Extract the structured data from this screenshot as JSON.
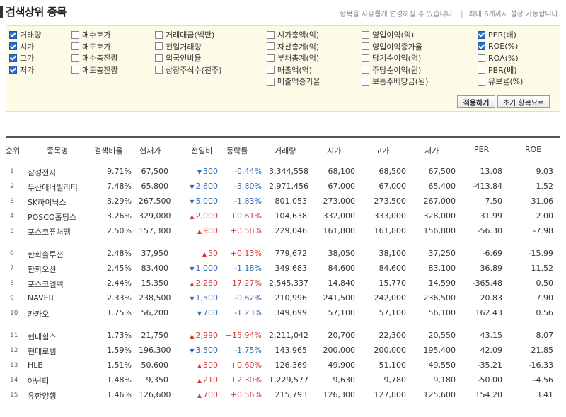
{
  "header": {
    "title": "검색상위 종목",
    "note_left": "항목을 자유롭게 변경하실 수 있습니다.",
    "note_sep": "|",
    "note_right": "최대 6개까지 설정 가능합니다."
  },
  "options": {
    "col1": [
      {
        "label": "거래량",
        "checked": true
      },
      {
        "label": "시가",
        "checked": true
      },
      {
        "label": "고가",
        "checked": true
      },
      {
        "label": "저가",
        "checked": true
      }
    ],
    "col2": [
      {
        "label": "매수호가",
        "checked": false
      },
      {
        "label": "매도호가",
        "checked": false
      },
      {
        "label": "매수총잔량",
        "checked": false
      },
      {
        "label": "매도총잔량",
        "checked": false
      }
    ],
    "col3": [
      {
        "label": "거래대금(백만)",
        "checked": false
      },
      {
        "label": "전일거래량",
        "checked": false
      },
      {
        "label": "외국인비율",
        "checked": false
      },
      {
        "label": "상장주식수(천주)",
        "checked": false
      }
    ],
    "col4": [
      {
        "label": "시가총액(억)",
        "checked": false
      },
      {
        "label": "자산총계(억)",
        "checked": false
      },
      {
        "label": "부채총계(억)",
        "checked": false
      },
      {
        "label": "매출액(억)",
        "checked": false
      },
      {
        "label": "매출액증가율",
        "checked": false
      }
    ],
    "col5": [
      {
        "label": "영업이익(억)",
        "checked": false
      },
      {
        "label": "영업이익증가율",
        "checked": false
      },
      {
        "label": "당기순이익(억)",
        "checked": false
      },
      {
        "label": "주당순이익(원)",
        "checked": false
      },
      {
        "label": "보통주배당금(원)",
        "checked": false
      }
    ],
    "col6": [
      {
        "label": "PER(배)",
        "checked": true
      },
      {
        "label": "ROE(%)",
        "checked": true
      },
      {
        "label": "ROA(%)",
        "checked": false
      },
      {
        "label": "PBR(배)",
        "checked": false
      },
      {
        "label": "유보율(%)",
        "checked": false
      }
    ],
    "apply_button": "적용하기",
    "reset_button": "초기 항목으로"
  },
  "table": {
    "headers": [
      "순위",
      "종목명",
      "검색비율",
      "현재가",
      "전일비",
      "등락률",
      "거래량",
      "시가",
      "고가",
      "저가",
      "PER",
      "ROE"
    ],
    "rows": [
      {
        "no": "1",
        "name": "삼성전자",
        "ratio": "9.71%",
        "price": "67,500",
        "dir": "down",
        "diff": "300",
        "rate": "-0.44%",
        "volume": "3,344,558",
        "open": "68,100",
        "high": "68,500",
        "low": "67,500",
        "per": "13.08",
        "roe": "9.03"
      },
      {
        "no": "2",
        "name": "두산에너빌리티",
        "ratio": "7.48%",
        "price": "65,800",
        "dir": "down",
        "diff": "2,600",
        "rate": "-3.80%",
        "volume": "2,971,456",
        "open": "67,000",
        "high": "67,000",
        "low": "65,400",
        "per": "-413.84",
        "roe": "1.52"
      },
      {
        "no": "3",
        "name": "SK하이닉스",
        "ratio": "3.29%",
        "price": "267,500",
        "dir": "down",
        "diff": "5,000",
        "rate": "-1.83%",
        "volume": "801,053",
        "open": "273,000",
        "high": "273,500",
        "low": "267,000",
        "per": "7.50",
        "roe": "31.06"
      },
      {
        "no": "4",
        "name": "POSCO홀딩스",
        "ratio": "3.26%",
        "price": "329,000",
        "dir": "up",
        "diff": "2,000",
        "rate": "+0.61%",
        "volume": "104,638",
        "open": "332,000",
        "high": "333,000",
        "low": "328,000",
        "per": "31.99",
        "roe": "2.00"
      },
      {
        "no": "5",
        "name": "포스코퓨처엠",
        "ratio": "2.50%",
        "price": "157,300",
        "dir": "up",
        "diff": "900",
        "rate": "+0.58%",
        "volume": "229,046",
        "open": "161,800",
        "high": "161,800",
        "low": "156,800",
        "per": "-56.30",
        "roe": "-7.98"
      },
      {
        "no": "6",
        "name": "한화솔루션",
        "ratio": "2.48%",
        "price": "37,950",
        "dir": "up",
        "diff": "50",
        "rate": "+0.13%",
        "volume": "779,672",
        "open": "38,050",
        "high": "38,100",
        "low": "37,250",
        "per": "-6.69",
        "roe": "-15.99"
      },
      {
        "no": "7",
        "name": "한화오션",
        "ratio": "2.45%",
        "price": "83,400",
        "dir": "down",
        "diff": "1,000",
        "rate": "-1.18%",
        "volume": "349,683",
        "open": "84,600",
        "high": "84,600",
        "low": "83,100",
        "per": "36.89",
        "roe": "11.52"
      },
      {
        "no": "8",
        "name": "포스코엠텍",
        "ratio": "2.44%",
        "price": "15,350",
        "dir": "up",
        "diff": "2,260",
        "rate": "+17.27%",
        "volume": "2,545,337",
        "open": "14,840",
        "high": "15,770",
        "low": "14,590",
        "per": "-365.48",
        "roe": "0.50"
      },
      {
        "no": "9",
        "name": "NAVER",
        "ratio": "2.33%",
        "price": "238,500",
        "dir": "down",
        "diff": "1,500",
        "rate": "-0.62%",
        "volume": "210,996",
        "open": "241,500",
        "high": "242,000",
        "low": "236,500",
        "per": "20.83",
        "roe": "7.90"
      },
      {
        "no": "10",
        "name": "카카오",
        "ratio": "1.75%",
        "price": "56,200",
        "dir": "down",
        "diff": "700",
        "rate": "-1.23%",
        "volume": "349,699",
        "open": "57,100",
        "high": "57,100",
        "low": "56,100",
        "per": "162.43",
        "roe": "0.56"
      },
      {
        "no": "11",
        "name": "현대힘스",
        "ratio": "1.73%",
        "price": "21,750",
        "dir": "up",
        "diff": "2,990",
        "rate": "+15.94%",
        "volume": "2,211,042",
        "open": "20,700",
        "high": "22,300",
        "low": "20,550",
        "per": "43.15",
        "roe": "8.07"
      },
      {
        "no": "12",
        "name": "현대로템",
        "ratio": "1.59%",
        "price": "196,300",
        "dir": "down",
        "diff": "3,500",
        "rate": "-1.75%",
        "volume": "143,965",
        "open": "200,000",
        "high": "200,000",
        "low": "195,400",
        "per": "42.09",
        "roe": "21.85"
      },
      {
        "no": "13",
        "name": "HLB",
        "ratio": "1.51%",
        "price": "50,600",
        "dir": "up",
        "diff": "300",
        "rate": "+0.60%",
        "volume": "126,369",
        "open": "49,900",
        "high": "51,100",
        "low": "49,550",
        "per": "-35.21",
        "roe": "-16.33"
      },
      {
        "no": "14",
        "name": "아난티",
        "ratio": "1.48%",
        "price": "9,350",
        "dir": "up",
        "diff": "210",
        "rate": "+2.30%",
        "volume": "1,229,577",
        "open": "9,630",
        "high": "9,780",
        "low": "9,180",
        "per": "-50.00",
        "roe": "-4.56"
      },
      {
        "no": "15",
        "name": "유한양행",
        "ratio": "1.46%",
        "price": "126,600",
        "dir": "up",
        "diff": "700",
        "rate": "+0.56%",
        "volume": "215,793",
        "open": "126,300",
        "high": "127,800",
        "low": "125,600",
        "per": "154.20",
        "roe": "3.41"
      }
    ]
  },
  "colors": {
    "up": "#d43c3c",
    "down": "#2f6bbf",
    "checkbox": "#2a6fc9",
    "option_bg": "#fdfbe8"
  }
}
